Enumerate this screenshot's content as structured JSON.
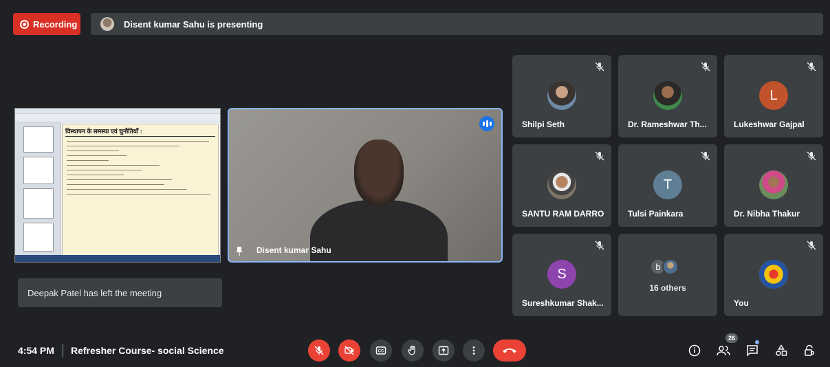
{
  "top_bar": {
    "recording_label": "Recording",
    "presenting_text": "Disent kumar Sahu is presenting"
  },
  "slide": {
    "heading": "विस्थापन के समस्या एवं चुनौतियाँ :"
  },
  "presenter": {
    "name": "Disent kumar Sahu"
  },
  "toast": {
    "message": "Deepak Patel has left the meeting"
  },
  "participants": [
    {
      "name": "Shilpi Seth",
      "avatar_type": "photo"
    },
    {
      "name": "Dr. Rameshwar Th...",
      "avatar_type": "photo"
    },
    {
      "name": "Lukeshwar Gajpal",
      "avatar_letter": "L",
      "avatar_color": "#c0532b"
    },
    {
      "name": "SANTU RAM DARRO",
      "avatar_type": "photo"
    },
    {
      "name": "Tulsi Painkara",
      "avatar_letter": "T",
      "avatar_color": "#5f7f95"
    },
    {
      "name": "Dr. Nibha Thakur",
      "avatar_type": "photo"
    },
    {
      "name": "Sureshkumar Shak...",
      "avatar_letter": "S",
      "avatar_color": "#8e44ad"
    },
    {
      "name": "16 others",
      "others_letter": "b"
    },
    {
      "name": "You",
      "avatar_type": "logo"
    }
  ],
  "bottom_bar": {
    "time": "4:54 PM",
    "meeting_title": "Refresher Course- social Science",
    "participant_count": "26"
  },
  "colors": {
    "background": "#202124",
    "tile": "#3c4043",
    "recording_red": "#d93025",
    "control_red": "#ea4335",
    "accent_blue": "#8ab4f8"
  }
}
